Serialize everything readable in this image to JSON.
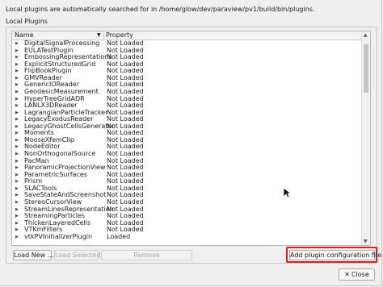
{
  "dialog": {
    "info_text": "Local plugins are automatically searched for in /home/glow/dev/paraview/pv1/build/bin/plugins.",
    "group_title": "Local Plugins"
  },
  "tree": {
    "columns": [
      "Name",
      "Property"
    ],
    "rows": [
      {
        "name": "DigitalSignalProcessing",
        "status": "Not Loaded"
      },
      {
        "name": "EULATestPlugin",
        "status": "Not Loaded"
      },
      {
        "name": "EmbossingRepresentations",
        "status": "Not Loaded"
      },
      {
        "name": "ExplicitStructuredGrid",
        "status": "Not Loaded"
      },
      {
        "name": "FlipBookPlugin",
        "status": "Not Loaded"
      },
      {
        "name": "GMVReader",
        "status": "Not Loaded"
      },
      {
        "name": "GenericIOReader",
        "status": "Not Loaded"
      },
      {
        "name": "GeodesicMeasurement",
        "status": "Not Loaded"
      },
      {
        "name": "HyperTreeGridADR",
        "status": "Not Loaded"
      },
      {
        "name": "LANLX3DReader",
        "status": "Not Loaded"
      },
      {
        "name": "LagrangianParticleTracker",
        "status": "Not Loaded"
      },
      {
        "name": "LegacyExodusReader",
        "status": "Not Loaded"
      },
      {
        "name": "LegacyGhostCellsGenerator",
        "status": "Not Loaded"
      },
      {
        "name": "Moments",
        "status": "Not Loaded"
      },
      {
        "name": "MooseXfemClip",
        "status": "Not Loaded"
      },
      {
        "name": "NodeEditor",
        "status": "Not Loaded"
      },
      {
        "name": "NonOrthogonalSource",
        "status": "Not Loaded"
      },
      {
        "name": "PacMan",
        "status": "Not Loaded"
      },
      {
        "name": "PanoramicProjectionView",
        "status": "Not Loaded"
      },
      {
        "name": "ParametricSurfaces",
        "status": "Not Loaded"
      },
      {
        "name": "Prism",
        "status": "Not Loaded"
      },
      {
        "name": "SLACTools",
        "status": "Not Loaded"
      },
      {
        "name": "SaveStateAndScreenshot",
        "status": "Not Loaded"
      },
      {
        "name": "StereoCursorView",
        "status": "Not Loaded"
      },
      {
        "name": "StreamLinesRepresentation",
        "status": "Not Loaded"
      },
      {
        "name": "StreamingParticles",
        "status": "Not Loaded"
      },
      {
        "name": "ThickenLayeredCells",
        "status": "Not Loaded"
      },
      {
        "name": "VTKmFilters",
        "status": "Not Loaded"
      },
      {
        "name": "vtkPVInitializerPlugin",
        "status": "Loaded"
      }
    ]
  },
  "buttons": {
    "load_new": "Load New ...",
    "load_selected": "Load Selected",
    "remove": "Remove",
    "add_config": "Add plugin configuration file",
    "close": "Close"
  },
  "colors": {
    "highlight": "#e02020"
  }
}
